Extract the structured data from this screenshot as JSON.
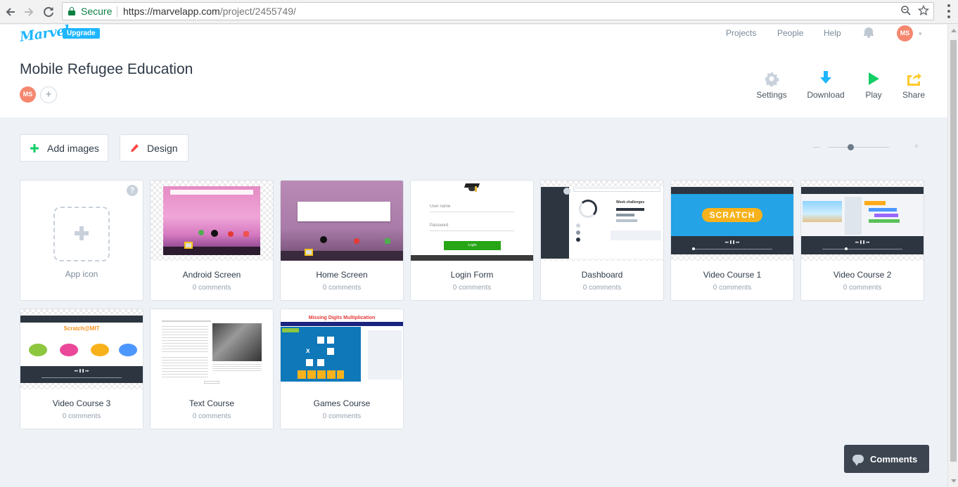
{
  "browser": {
    "secure_label": "Secure",
    "url_host": "https://marvelapp.com",
    "url_path": "/project/2455749/",
    "back_icon": "arrow-left-icon",
    "forward_icon": "arrow-right-icon",
    "reload_icon": "reload-icon",
    "zoom_icon": "magnifier-icon",
    "bookmark_icon": "star-icon",
    "menu_icon": "vertical-dots-icon"
  },
  "header": {
    "logo_text": "Marvel",
    "upgrade_label": "Upgrade",
    "nav": [
      "Projects",
      "People",
      "Help"
    ],
    "user_initials": "MS",
    "project_title": "Mobile Refugee Education",
    "member_initials": "MS",
    "add_member_label": "+",
    "actions": [
      {
        "label": "Settings",
        "icon": "gear-icon",
        "color": "#c9d1db"
      },
      {
        "label": "Download",
        "icon": "download-arrow-icon",
        "color": "#1fb6ff"
      },
      {
        "label": "Play",
        "icon": "play-icon",
        "color": "#13ce66"
      },
      {
        "label": "Share",
        "icon": "share-icon",
        "color": "#ffc82c"
      }
    ]
  },
  "toolbar": {
    "add_images_label": "Add images",
    "design_label": "Design"
  },
  "app_icon": {
    "label": "App icon",
    "help_label": "?"
  },
  "screens": [
    {
      "title": "Android Screen",
      "comments": "0 comments"
    },
    {
      "title": "Home Screen",
      "comments": "0 comments"
    },
    {
      "title": "Login Form",
      "comments": "0 comments"
    },
    {
      "title": "Dashboard",
      "comments": "0 comments"
    },
    {
      "title": "Video Course 1",
      "comments": "0 comments"
    },
    {
      "title": "Video Course 2",
      "comments": "0 comments"
    },
    {
      "title": "Video Course 3",
      "comments": "0 comments"
    },
    {
      "title": "Text Course",
      "comments": "0 comments"
    },
    {
      "title": "Games Course",
      "comments": "0 comments"
    }
  ],
  "thumb_text": {
    "login": {
      "user": "User name",
      "password": "Password",
      "button": "Login"
    },
    "scratch_logo": "SCRATCH",
    "scratch_mit": "Scratch@MIT",
    "games_title": "Missing Digits Multiplication",
    "dashboard_heading": "Week challenges"
  },
  "comments_button": {
    "label": "Comments"
  },
  "colors": {
    "accent": "#1fb6ff",
    "avatar": "#f5876f",
    "play": "#13ce66",
    "share": "#ffc82c",
    "login_button": "#26a515"
  }
}
